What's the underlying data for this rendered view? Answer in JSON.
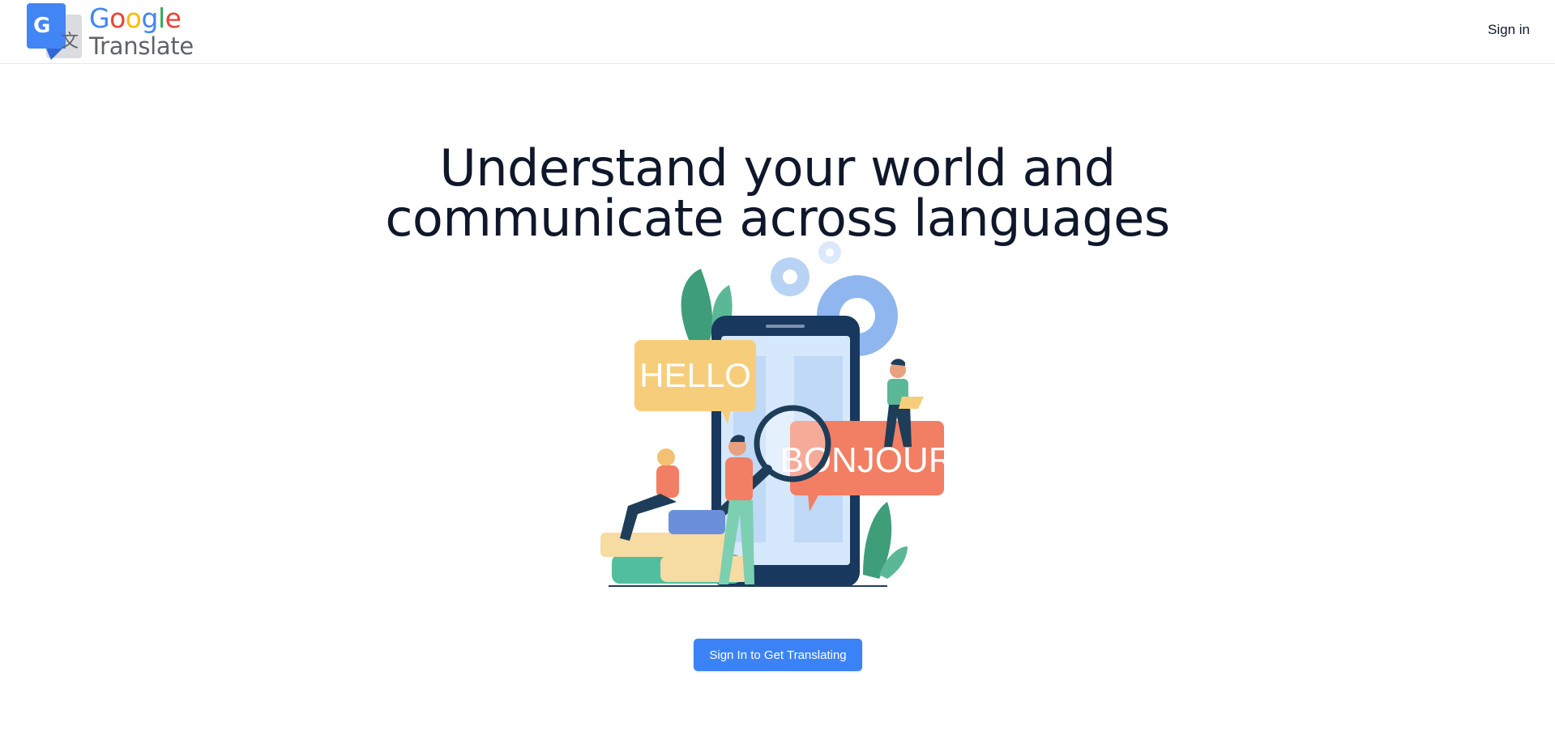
{
  "header": {
    "logo_word1_letters": [
      "G",
      "o",
      "o",
      "g",
      "l",
      "e"
    ],
    "logo_word2": "Translate",
    "signin_label": "Sign in"
  },
  "hero": {
    "headline_line1": "Understand your world and",
    "headline_line2": "communicate across languages",
    "bubble_left": "HELLO",
    "bubble_right": "BONJOUR",
    "cta_label": "Sign In to Get Translating"
  },
  "colors": {
    "accent": "#3b82f6",
    "google_blue": "#4285f4",
    "google_red": "#ea4335",
    "google_yellow": "#fbbc05",
    "google_green": "#34a853"
  }
}
